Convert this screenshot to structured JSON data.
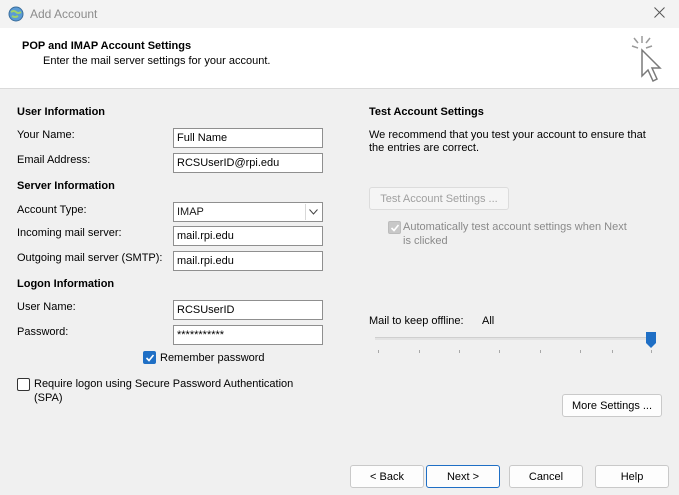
{
  "window": {
    "title": "Add Account",
    "icons": {
      "app": "outlook-globe-icon",
      "close": "close-icon"
    }
  },
  "header": {
    "title": "POP and IMAP Account Settings",
    "subtitle": "Enter the mail server settings for your account.",
    "icon": "click-cursor-icon"
  },
  "user_info": {
    "heading": "User Information",
    "your_name_label": "Your Name:",
    "your_name_value": "Full Name",
    "email_label": "Email Address:",
    "email_value": "RCSUserID@rpi.edu"
  },
  "server_info": {
    "heading": "Server Information",
    "account_type_label": "Account Type:",
    "account_type_value": "IMAP",
    "incoming_label": "Incoming mail server:",
    "incoming_value": "mail.rpi.edu",
    "outgoing_label": "Outgoing mail server (SMTP):",
    "outgoing_value": "mail.rpi.edu"
  },
  "logon_info": {
    "heading": "Logon Information",
    "username_label": "User Name:",
    "username_value": "RCSUserID",
    "password_label": "Password:",
    "password_value": "***********",
    "remember_password_label": "Remember password",
    "remember_password_checked": true,
    "spa_label_line1": "Require logon using Secure Password Authentication",
    "spa_label_line2": "(SPA)",
    "spa_checked": false
  },
  "test_settings": {
    "heading": "Test Account Settings",
    "description_line1": "We recommend that you test your account to ensure that",
    "description_line2": "the entries are correct.",
    "test_button_label": "Test Account Settings ...",
    "auto_test_label_line1": "Automatically test account settings when Next",
    "auto_test_label_line2": "is clicked",
    "auto_test_checked": true
  },
  "offline": {
    "label": "Mail to keep offline:",
    "value": "All",
    "slider_level": 1.0
  },
  "buttons": {
    "more_settings": "More Settings ...",
    "back": "< Back",
    "next": "Next >",
    "cancel": "Cancel",
    "help": "Help"
  },
  "colors": {
    "accent": "#1f6fc5",
    "header_bg": "#ffffff",
    "dialog_bg": "#f0f0f0"
  }
}
